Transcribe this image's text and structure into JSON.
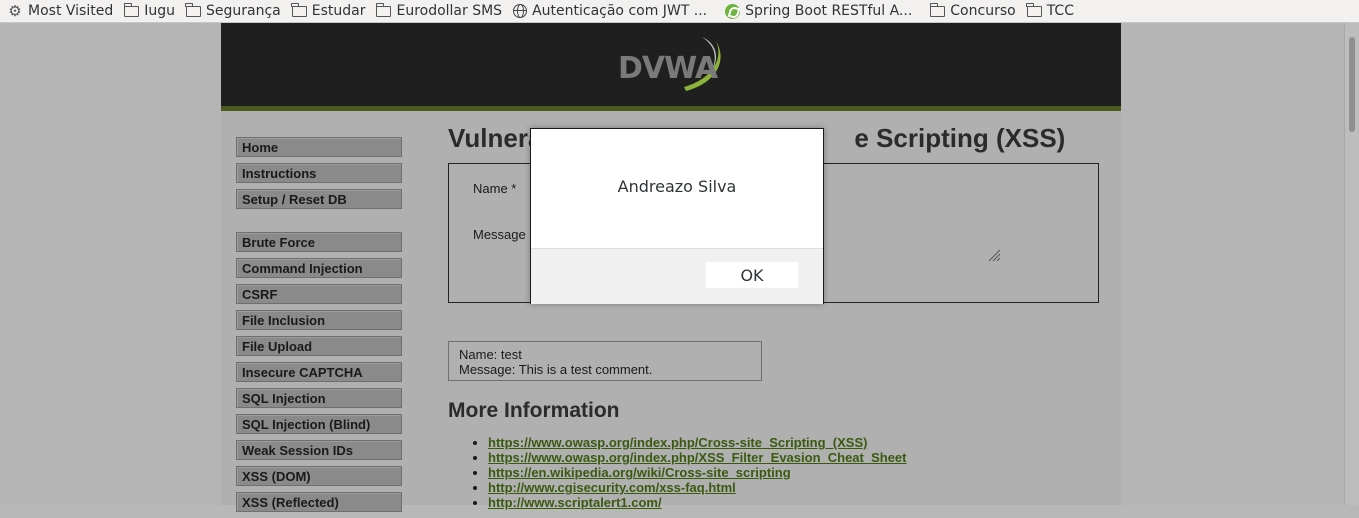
{
  "bookmarks": [
    {
      "label": "Most Visited",
      "icon": "gear-icon"
    },
    {
      "label": "Iugu",
      "icon": "folder-icon"
    },
    {
      "label": "Segurança",
      "icon": "folder-icon"
    },
    {
      "label": "Estudar",
      "icon": "folder-icon"
    },
    {
      "label": "Eurodollar SMS",
      "icon": "folder-icon"
    },
    {
      "label": "Autenticação com JWT ...",
      "icon": "globe-icon"
    },
    {
      "label": "Spring Boot RESTful A...",
      "icon": "spring-icon"
    },
    {
      "label": "Concurso",
      "icon": "folder-icon"
    },
    {
      "label": "TCC",
      "icon": "folder-icon"
    }
  ],
  "header": {
    "logo_text": "DVWA"
  },
  "menu": {
    "group1": [
      "Home",
      "Instructions",
      "Setup / Reset DB"
    ],
    "group2": [
      "Brute Force",
      "Command Injection",
      "CSRF",
      "File Inclusion",
      "File Upload",
      "Insecure CAPTCHA",
      "SQL Injection",
      "SQL Injection (Blind)",
      "Weak Session IDs",
      "XSS (DOM)",
      "XSS (Reflected)"
    ]
  },
  "main": {
    "title_left": "Vulnera",
    "title_right": "e Scripting (XSS)",
    "form": {
      "name_label": "Name *",
      "message_label": "Message"
    },
    "entry": {
      "name_line": "Name: test",
      "message_line": "Message: This is a test comment."
    },
    "more_info_title": "More Information",
    "links": [
      "https://www.owasp.org/index.php/Cross-site_Scripting_(XSS)",
      "https://www.owasp.org/index.php/XSS_Filter_Evasion_Cheat_Sheet",
      "https://en.wikipedia.org/wiki/Cross-site_scripting",
      "http://www.cgisecurity.com/xss-faq.html",
      "http://www.scriptalert1.com/"
    ]
  },
  "dialog": {
    "message": "Andreazo Silva",
    "ok_label": "OK"
  },
  "colors": {
    "header_bg": "#1f1f1f",
    "header_border": "#4a5a1e",
    "link": "#3a5a10",
    "logo_swoosh": "#8db33a"
  }
}
